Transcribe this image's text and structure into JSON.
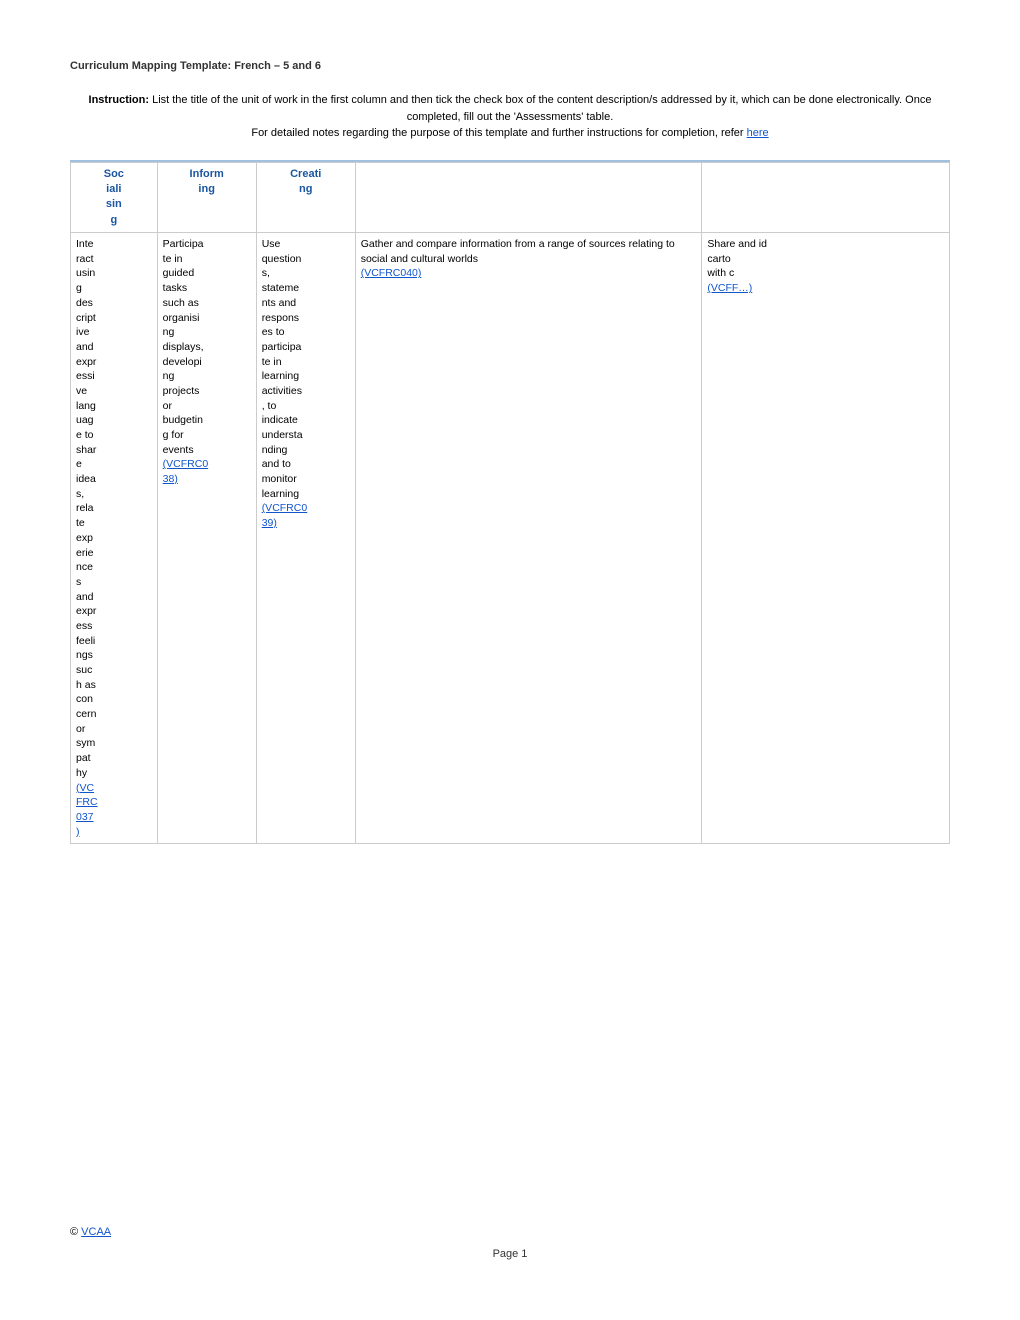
{
  "doc_title": "Curriculum Mapping Template: French – 5 and 6",
  "instruction": {
    "prefix_bold": "Instruction:",
    "text": " List the title of the unit of work in the first column and then tick the check box of the content description/s addressed by it, which can be done electronically. Once completed, fill out the 'Assessments' table.",
    "second_line": "For detailed notes regarding the purpose of this template and further instructions for completion, refer ",
    "link_text": "here",
    "link_href": "#"
  },
  "table": {
    "headers": [
      {
        "id": "socialising",
        "label": "Socialising"
      },
      {
        "id": "informing",
        "label": "Informing"
      },
      {
        "id": "creating",
        "label": "Creating"
      },
      {
        "id": "wide1",
        "label": ""
      },
      {
        "id": "wide2",
        "label": ""
      }
    ],
    "rows": [
      {
        "col_socialising": "Interact using descriptive and expressive language to share ideas, relate experiences and express feelings such as concern or sympathy",
        "col_socialising_link": "(VCFRC037)",
        "col_socialising_link_href": "#",
        "col_informing": "Participate in guided tasks such as organising displays, developing projects or budgeting for events",
        "col_informing_link": "(VCFRC038)",
        "col_informing_link_href": "#",
        "col_creating": "Use questions, statements and responses to participate in learning activities , to indicate understanding and to monitor learning",
        "col_creating_link": "(VCFRC039)",
        "col_creating_link_href": "#",
        "col_wide1": "Gather and compare information from a range of sources relating to social and cultural worlds",
        "col_wide1_link": "(VCFRC040)",
        "col_wide1_link_href": "#",
        "col_wide2": "Share and id carto with c",
        "col_wide2_link": "(VCFF…)",
        "col_wide2_link_href": "#"
      }
    ]
  },
  "footer": {
    "copyright": "© ",
    "link_text": "VCAA",
    "link_href": "#"
  },
  "page_number": "Page 1"
}
